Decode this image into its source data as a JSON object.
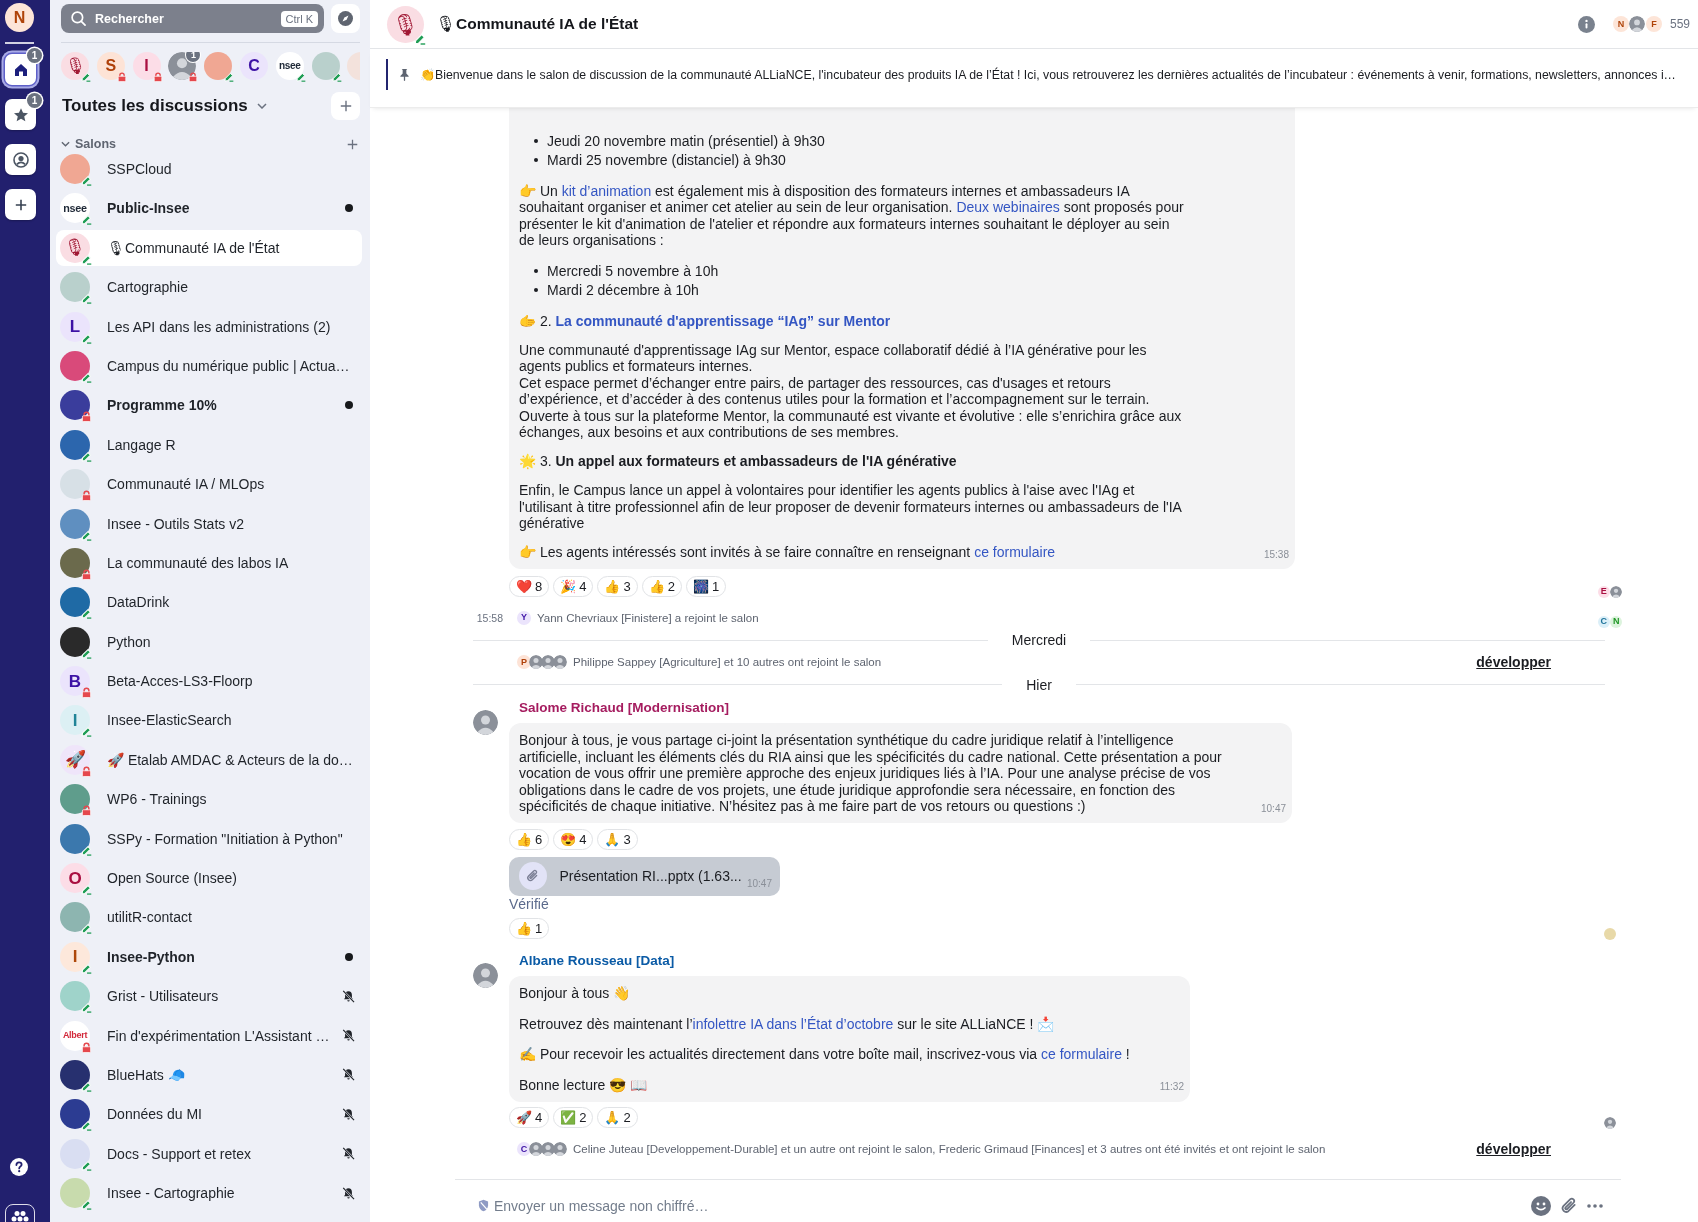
{
  "rail": {
    "avatar": {
      "kind": "letter",
      "text": "N",
      "color": "#fde5d8"
    },
    "spaces": [
      {
        "kind": "home",
        "selected": true,
        "badge": "1"
      },
      {
        "kind": "favourites",
        "selected": false,
        "badge": "1"
      },
      {
        "kind": "people",
        "selected": false
      },
      {
        "kind": "create",
        "selected": false
      }
    ]
  },
  "sidebar": {
    "search": {
      "label": "Rechercher",
      "shortcut": "Ctrl K"
    },
    "recents": [
      {
        "avatar": {
          "kind": "letter",
          "text": "🎙",
          "color": "#fadde3"
        },
        "private": false
      },
      {
        "avatar": {
          "kind": "letter",
          "text": "S",
          "color": "#fde3d6"
        },
        "private": true
      },
      {
        "avatar": {
          "kind": "letter",
          "text": "I",
          "color": "#fcdde7"
        },
        "private": true
      },
      {
        "avatar": {
          "kind": "photo"
        },
        "private": true,
        "count": "1"
      },
      {
        "avatar": {
          "kind": "image",
          "color": "#f0a793"
        },
        "private": false
      },
      {
        "avatar": {
          "kind": "letter",
          "text": "C",
          "color": "#ebe4fc"
        }
      },
      {
        "avatar": {
          "kind": "text",
          "text": "nsee",
          "color": "#1f2937"
        },
        "private": false
      },
      {
        "avatar": {
          "kind": "image",
          "color": "#b9d0cc"
        },
        "private": false
      },
      {
        "avatar": {
          "kind": "image",
          "color": "#f3e2dc"
        }
      }
    ],
    "title": "Toutes les discussions",
    "section": {
      "label": "Salons",
      "expanded": true
    },
    "rooms": [
      {
        "name": "SSPCloud",
        "avatar": {
          "kind": "image",
          "color": "#f0a793"
        },
        "private": false,
        "selected": false,
        "unread": false,
        "muted": false
      },
      {
        "name": "Public-Insee",
        "avatar": {
          "kind": "text",
          "text": "nsee",
          "color": "#1f2937"
        },
        "private": false,
        "selected": false,
        "unread": true,
        "muted": false
      },
      {
        "name": "🎙Communauté IA de l'État",
        "avatar": {
          "kind": "letter",
          "text": "🎙",
          "color": "#fadde3"
        },
        "private": false,
        "selected": true,
        "unread": false,
        "muted": false
      },
      {
        "name": "Cartographie",
        "avatar": {
          "kind": "image",
          "color": "#b9d0cc"
        },
        "private": false,
        "selected": false,
        "unread": false,
        "muted": false
      },
      {
        "name": "Les API dans les administrations (2)",
        "avatar": {
          "kind": "letter",
          "text": "L",
          "color": "#ebe4fc"
        },
        "private": false,
        "selected": false,
        "unread": false,
        "muted": false
      },
      {
        "name": "Campus du numérique public | Actua…",
        "avatar": {
          "kind": "image",
          "color": "#d94a7a"
        },
        "private": false,
        "selected": false,
        "unread": false,
        "muted": false
      },
      {
        "name": "Programme 10%",
        "avatar": {
          "kind": "image",
          "color": "#3a3d9c"
        },
        "private": true,
        "selected": false,
        "unread": true,
        "muted": false
      },
      {
        "name": "Langage R",
        "avatar": {
          "kind": "image",
          "color": "#2c66ad"
        },
        "private": false,
        "selected": false,
        "unread": false,
        "muted": false
      },
      {
        "name": "Communauté IA / MLOps",
        "avatar": {
          "kind": "image",
          "color": "#d7e0e6"
        },
        "private": true,
        "selected": false,
        "unread": false,
        "muted": false
      },
      {
        "name": "Insee - Outils Stats v2",
        "avatar": {
          "kind": "image",
          "color": "#5f8fc0"
        },
        "private": false,
        "selected": false,
        "unread": false,
        "muted": false
      },
      {
        "name": "La communauté des labos IA",
        "avatar": {
          "kind": "image",
          "color": "#6b6a4c"
        },
        "private": true,
        "selected": false,
        "unread": false,
        "muted": false
      },
      {
        "name": "DataDrink",
        "avatar": {
          "kind": "image",
          "color": "#1f6aa5"
        },
        "private": false,
        "selected": false,
        "unread": false,
        "muted": false
      },
      {
        "name": "Python",
        "avatar": {
          "kind": "image",
          "color": "#2a2a2a"
        },
        "private": false,
        "selected": false,
        "unread": false,
        "muted": false
      },
      {
        "name": "Beta-Acces-LS3-Floorp",
        "avatar": {
          "kind": "letter",
          "text": "B",
          "color": "#ebe4fc"
        },
        "private": true,
        "selected": false,
        "unread": false,
        "muted": false
      },
      {
        "name": "Insee-ElasticSearch",
        "avatar": {
          "kind": "letter",
          "text": "I",
          "color": "#dcf0f4"
        },
        "private": false,
        "selected": false,
        "unread": false,
        "muted": false
      },
      {
        "name": "🚀 Etalab AMDAC & Acteurs de la do…",
        "avatar": {
          "kind": "letter",
          "text": "🚀",
          "color": "#efe5fa"
        },
        "private": true,
        "selected": false,
        "unread": false,
        "muted": false
      },
      {
        "name": "WP6 - Trainings",
        "avatar": {
          "kind": "image",
          "color": "#5f9d8c"
        },
        "private": true,
        "selected": false,
        "unread": false,
        "muted": false
      },
      {
        "name": "SSPy - Formation \"Initiation à Python\"",
        "avatar": {
          "kind": "image",
          "color": "#3b78ad"
        },
        "private": false,
        "selected": false,
        "unread": false,
        "muted": false
      },
      {
        "name": "Open Source (Insee)",
        "avatar": {
          "kind": "letter",
          "text": "O",
          "color": "#fcdde7"
        },
        "private": false,
        "selected": false,
        "unread": false,
        "muted": false
      },
      {
        "name": "utilitR-contact",
        "avatar": {
          "kind": "image",
          "color": "#8db5b0"
        },
        "private": false,
        "selected": false,
        "unread": false,
        "muted": false
      },
      {
        "name": "Insee-Python",
        "avatar": {
          "kind": "letter",
          "text": "I",
          "color": "#fde8db"
        },
        "private": false,
        "selected": false,
        "unread": true,
        "muted": false
      },
      {
        "name": "Grist - Utilisateurs",
        "avatar": {
          "kind": "image",
          "color": "#9fd3ca"
        },
        "private": false,
        "selected": false,
        "unread": false,
        "muted": true
      },
      {
        "name": "Fin d'expérimentation L'Assistant …",
        "avatar": {
          "kind": "text",
          "text": "Albert",
          "color": "#d2283a"
        },
        "private": true,
        "selected": false,
        "unread": false,
        "muted": true
      },
      {
        "name": "BlueHats 🧢",
        "avatar": {
          "kind": "image",
          "color": "#27306f"
        },
        "private": false,
        "selected": false,
        "unread": false,
        "muted": true
      },
      {
        "name": "Données du MI",
        "avatar": {
          "kind": "image",
          "color": "#2c3c92"
        },
        "private": false,
        "selected": false,
        "unread": false,
        "muted": true
      },
      {
        "name": "Docs - Support et retex",
        "avatar": {
          "kind": "image",
          "color": "#d9def2"
        },
        "private": false,
        "selected": false,
        "unread": false,
        "muted": true
      },
      {
        "name": "Insee - Cartographie",
        "avatar": {
          "kind": "image",
          "color": "#c8dbad"
        },
        "private": false,
        "selected": false,
        "unread": false,
        "muted": true
      }
    ]
  },
  "header": {
    "avatar": {
      "kind": "letter",
      "text": "🎙",
      "color": "#fadde3"
    },
    "private": false,
    "title": "🎙Communauté IA de l'État",
    "members": {
      "avatars": [
        {
          "kind": "letter",
          "text": "N",
          "color": "#fde5d8"
        },
        {
          "kind": "photo"
        },
        {
          "kind": "letter",
          "text": "F",
          "color": "#fde5d8"
        }
      ],
      "count": "559"
    }
  },
  "pinned": {
    "text": "👏Bienvenue dans le salon de discussion de la communauté ALLiaNCE, l'incubateur des produits IA de l’État ! Ici, vous retrouverez les dernières actualités de l’incubateur : événements à venir, formations, newsletters, annonces i…"
  },
  "timeline": [
    {
      "kind": "message",
      "blocks": [
        {
          "kind": "list",
          "items": [
            "Jeudi 20 novembre matin (présentiel) à 9h30",
            "Mardi 25 novembre (distanciel) à 9h30"
          ]
        },
        {
          "kind": "paragraph",
          "parts": [
            {
              "kind": "text",
              "text": "👉 Un "
            },
            {
              "kind": "link",
              "text": "kit d’animation"
            },
            {
              "kind": "text",
              "text": " est également mis à disposition des formateurs internes et ambassadeurs IA souhaitant organiser et animer cet atelier au sein de leur organisation. "
            },
            {
              "kind": "link",
              "text": "Deux webinaires"
            },
            {
              "kind": "text",
              "text": " sont proposés pour présenter le kit d'animation de l'atelier et répondre aux formateurs internes souhaitant le déployer au sein de leurs organisations :"
            }
          ]
        },
        {
          "kind": "list",
          "items": [
            "Mercredi 5 novembre à 10h",
            "Mardi 2 décembre à 10h"
          ]
        },
        {
          "kind": "paragraph",
          "parts": [
            {
              "kind": "text",
              "text": "🫱 2. "
            },
            {
              "kind": "link",
              "text": "**La communauté d'apprentissage “IAg” sur Mentor**"
            }
          ]
        },
        {
          "kind": "paragraph",
          "parts": [
            {
              "kind": "text",
              "text": "Une communauté d'apprentissage IAg sur Mentor, espace collaboratif dédié à l’IA générative pour les agents publics et formateurs internes.\nCet espace permet d’échanger entre pairs, de partager des ressources, cas d'usages et retours d’expérience, et d’accéder à des contenus utiles pour la formation et l’accompagnement sur le terrain.\nOuverte à tous sur la plateforme Mentor, la communauté est vivante et évolutive : elle s’enrichira grâce aux échanges, aux besoins et aux contributions de ses membres."
            }
          ]
        },
        {
          "kind": "paragraph",
          "parts": [
            {
              "kind": "text",
              "text": "🌟 3. **Un appel aux formateurs et ambassadeurs de l'IA générative**"
            }
          ]
        },
        {
          "kind": "paragraph",
          "parts": [
            {
              "kind": "text",
              "text": "Enfin, le Campus lance un appel à volontaires pour identifier les agents publics à l'aise avec l'IAg et l'utilisant à titre professionnel afin de leur proposer de devenir formateurs internes ou ambassadeurs de l'IA générative"
            }
          ]
        },
        {
          "kind": "paragraph",
          "parts": [
            {
              "kind": "text",
              "text": "👉 Les agents intéressés sont invités à se faire connaître en renseignant "
            },
            {
              "kind": "link",
              "text": "ce formulaire"
            }
          ]
        }
      ],
      "time": "15:38",
      "reactions": [
        {
          "emoji": "❤️",
          "count": "8"
        },
        {
          "emoji": "🎉",
          "count": "4"
        },
        {
          "emoji": "👍",
          "count": "3"
        },
        {
          "emoji": "👍",
          "count": "2"
        },
        {
          "emoji": "🎆",
          "count": "1"
        }
      ],
      "receipts": [
        {
          "kind": "letter",
          "text": "E",
          "color": "#fcdde7"
        },
        {
          "kind": "photo"
        }
      ]
    },
    {
      "kind": "event",
      "time": "15:58",
      "avatars": [
        {
          "kind": "letter",
          "text": "Y",
          "color": "#ebe4fc"
        }
      ],
      "text": "Yann Chevriaux [Finistere] a rejoint le salon",
      "receipts": [
        {
          "kind": "letter",
          "text": "C",
          "color": "#dbeff8"
        },
        {
          "kind": "letter",
          "text": "N",
          "color": "#dcf3dd"
        }
      ]
    },
    {
      "kind": "divider",
      "label": "Mercredi"
    },
    {
      "kind": "event",
      "avatars": [
        {
          "kind": "letter",
          "text": "P",
          "color": "#fde3d6"
        },
        {
          "kind": "photo"
        },
        {
          "kind": "photo"
        },
        {
          "kind": "photo"
        }
      ],
      "text": "Philippe Sappey [Agriculture] et 10 autres ont rejoint le salon",
      "action": "développer"
    },
    {
      "kind": "divider",
      "label": "Hier"
    },
    {
      "kind": "message",
      "sender": "Salome Richaud [Modernisation]",
      "color": "#a51c5f",
      "avatar": {
        "kind": "photo"
      },
      "blocks": [
        {
          "kind": "paragraph",
          "parts": [
            {
              "kind": "text",
              "text": "Bonjour à tous, je vous partage ci-joint la présentation synthétique du cadre juridique relatif à l’intelligence artificielle, incluant les éléments clés du RIA ainsi que les spécificités du cadre national. Cette présentation a pour vocation de vous offrir une première approche des enjeux juridiques liés à l’IA. Pour une analyse précise de vos obligations dans le cadre de vos projets, une étude juridique approfondie sera nécessaire, en fonction des spécificités de chaque initiative. N’hésitez pas à me faire part de vos retours ou questions :)"
            }
          ]
        }
      ],
      "time": "10:47",
      "reactions": [
        {
          "emoji": "👍",
          "count": "6"
        },
        {
          "emoji": "😍",
          "count": "4"
        },
        {
          "emoji": "🙏",
          "count": "3"
        }
      ]
    },
    {
      "kind": "file",
      "name": "Présentation RI...pptx (1.63...",
      "time": "10:47",
      "note": "Vérifié",
      "reactions": [
        {
          "emoji": "👍",
          "count": "1"
        }
      ],
      "receipts": [
        {
          "kind": "image",
          "color": "#e8d9a8"
        }
      ]
    },
    {
      "kind": "message",
      "sender": "Albane Rousseau [Data]",
      "color": "#0b5ba6",
      "avatar": {
        "kind": "photo"
      },
      "blocks": [
        {
          "kind": "paragraph",
          "parts": [
            {
              "kind": "text",
              "text": "Bonjour à tous 👋"
            }
          ]
        },
        {
          "kind": "paragraph",
          "parts": [
            {
              "kind": "text",
              "text": "Retrouvez dès maintenant l’"
            },
            {
              "kind": "link",
              "text": "infolettre IA dans l’État d’octobre"
            },
            {
              "kind": "text",
              "text": " sur le site ALLiaNCE ! 📩"
            }
          ]
        },
        {
          "kind": "paragraph",
          "parts": [
            {
              "kind": "text",
              "text": "✍️ Pour recevoir les actualités directement dans votre boîte mail, inscrivez-vous via "
            },
            {
              "kind": "link",
              "text": "ce formulaire"
            },
            {
              "kind": "text",
              "text": " !"
            }
          ]
        },
        {
          "kind": "paragraph",
          "parts": [
            {
              "kind": "text",
              "text": "Bonne lecture 😎 📖"
            }
          ]
        }
      ],
      "time": "11:32",
      "reactions": [
        {
          "emoji": "🚀",
          "count": "4"
        },
        {
          "emoji": "✅",
          "count": "2"
        },
        {
          "emoji": "🙏",
          "count": "2"
        }
      ],
      "receipts": [
        {
          "kind": "photo"
        }
      ]
    },
    {
      "kind": "event",
      "avatars": [
        {
          "kind": "letter",
          "text": "C",
          "color": "#ebe4fc"
        },
        {
          "kind": "photo"
        },
        {
          "kind": "photo"
        },
        {
          "kind": "photo"
        }
      ],
      "text": "Celine Juteau [Developpement-Durable] et un autre ont rejoint le salon, Frederic Grimaud [Finances] et 3 autres ont été invités et ont rejoint le salon",
      "action": "développer"
    }
  ],
  "composer": {
    "placeholder": "Envoyer un message non chiffré…"
  }
}
